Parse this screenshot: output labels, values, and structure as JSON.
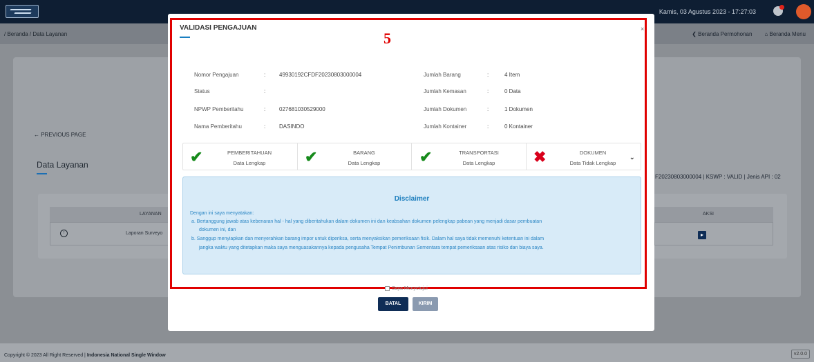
{
  "header": {
    "datetime": "Kamis, 03 Agustus 2023 - 17:27:03"
  },
  "breadcrumb": "/ Beranda / Data Layanan",
  "nav": {
    "beranda_permohonan": "❮ Beranda Permohonan",
    "beranda_menu": "⌂ Beranda Menu"
  },
  "page": {
    "previous_page": "←  PREVIOUS PAGE",
    "title": "Data Layanan",
    "right_info": "F20230803000004 | KSWP : VALID | Jenis API : 02",
    "table": {
      "col_layanan": "LAYANAN",
      "col_aksi": "AKSI",
      "row_layanan": "Laporan Surveyo",
      "row_up_icon": "↑",
      "row_aksi_icon": "▸"
    }
  },
  "modal": {
    "title": "VALIDASI PENGAJUAN",
    "close": "×",
    "annotation_number": "5",
    "info_left": [
      {
        "label": "Nomor Pengajuan",
        "value": "49930192CFDF20230803000004"
      },
      {
        "label": "Status",
        "value": ""
      },
      {
        "label": "NPWP Pemberitahu",
        "value": "027681030529000"
      },
      {
        "label": "Nama Pemberitahu",
        "value": "DASINDO"
      }
    ],
    "info_right": [
      {
        "label": "Jumlah Barang",
        "value": "4 Item"
      },
      {
        "label": "Jumlah Kemasan",
        "value": "0 Data"
      },
      {
        "label": "Jumlah Dokumen",
        "value": "1 Dokumen"
      },
      {
        "label": "Jumlah Kontainer",
        "value": "0 Kontainer"
      }
    ],
    "colon": ":",
    "steps": [
      {
        "title": "PEMBERITAHUAN",
        "status": "Data Lengkap",
        "icon": "✔"
      },
      {
        "title": "BARANG",
        "status": "Data Lengkap",
        "icon": "✔"
      },
      {
        "title": "TRANSPORTASI",
        "status": "Data Lengkap",
        "icon": "✔"
      },
      {
        "title": "DOKUMEN",
        "status": "Data Tidak Lengkap",
        "icon": "✖"
      }
    ],
    "chevron": "⌄",
    "disclaimer": {
      "title": "Disclaimer",
      "lines": [
        "Dengan ini saya menyatakan:",
        "a. Bertanggung jawab atas kebenaran hal - hal yang diberitahukan dalam dokumen ini dan keabsahan dokumen pelengkap pabean yang menjadi dasar pembuatan",
        "dokumen ini, dan",
        "b. Sanggup menyiapkan dan menyerahkan barang impor untuk diperiksa, serta menyaksikan pemeriksaan fisik. Dalam hal saya tidak memenuhi ketentuan ini dalam",
        "jangka waktu yang ditetapkan maka saya menguasakannya kepada pengusaha Tempat Penimbunan Sementara tempat pemeriksaan atas risiko dan biaya saya."
      ]
    },
    "agree_label": "Saya Menyetujui",
    "btn_batal": "BATAL",
    "btn_kirim": "KIRIM"
  },
  "footer": {
    "copyright": "Copyright © 2023 All Right Reserved | ",
    "org": "Indonesia National Single Window",
    "version": "v2.0.0"
  }
}
